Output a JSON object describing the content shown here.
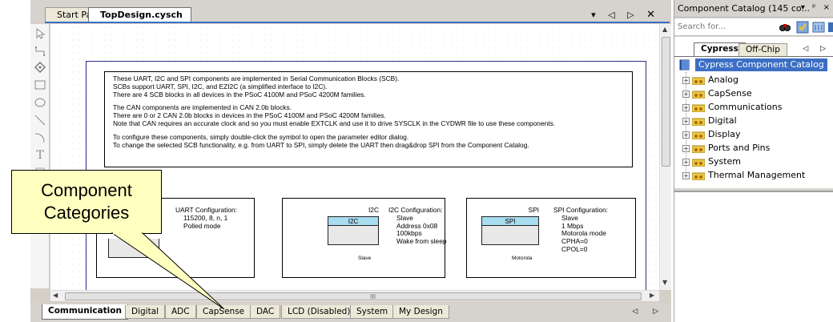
{
  "document": {
    "tabs": [
      {
        "label": "Start Page",
        "active": false
      },
      {
        "label": "TopDesign.cysch",
        "active": true
      }
    ],
    "controls": [
      "▾",
      "◁",
      "▷",
      "✕"
    ]
  },
  "toolbox": {
    "tools": [
      "pointer-tool-icon",
      "wire-tool-icon",
      "diamond-tool-icon",
      "rectangle-tool-icon",
      "ellipse-tool-icon",
      "line-tool-icon",
      "arc-tool-icon",
      "text-tool-icon",
      "image-tool-icon"
    ],
    "text_tool_glyph": "T"
  },
  "schematic": {
    "note_paragraphs": [
      [
        "These UART, I2C and SPI components are implemented in Serial Communication Blocks (SCB).",
        "SCBs support UART, SPI, I2C, and EZI2C (a simplified interface to I2C).",
        "There are 4 SCB blocks in all devices in the PSoC 4100M and PSoC 4200M families."
      ],
      [
        "The CAN components are implemented in CAN 2.0b blocks.",
        "There are 0 or 2 CAN 2.0b blocks in devices in the PSoC 4100M and PSoC 4200M families.",
        "Note that CAN requires an accurate clock and so you must enable EXTCLK and use it to drive SYSCLK in the CYDWR file to use these components."
      ],
      [
        "To configure these components, simply double-click the symbol to open the parameter editor dialog.",
        "To change the selected SCB functionality, e.g. from UART to SPI, simply delete the UART then drag&drop SPI from the Component Catalog."
      ]
    ],
    "uart": {
      "config_title": "UART Configuration:",
      "config_values": [
        "115200, 8, n, 1",
        "Polled mode"
      ],
      "symbol_sub_fragment": "d"
    },
    "i2c": {
      "symbol_name": "I2C",
      "symbol_band": "I2C",
      "symbol_sub": "Slave",
      "config_title": "I2C Configuration:",
      "config_values": [
        "Slave",
        "Address 0x08",
        "100kbps",
        "Wake from sleep"
      ]
    },
    "spi": {
      "symbol_name": "SPI",
      "symbol_band": "SPI",
      "symbol_sub": "Motorola",
      "config_title": "SPI Configuration:",
      "config_values": [
        "Slave",
        "1 Mbps",
        "Motorola mode",
        "CPHA=0",
        "CPOL=0"
      ]
    }
  },
  "scrollbars": {
    "vertical": {
      "up": "▲",
      "down": "▼"
    },
    "horizontal": {
      "left": "◀",
      "right": "▶",
      "grip": "III"
    }
  },
  "sheet_tabs": {
    "tabs": [
      "Communication",
      "Digital",
      "ADC",
      "CapSense",
      "DAC",
      "LCD (Disabled)",
      "System",
      "My Design"
    ],
    "active_index": 0,
    "nav": [
      "◁",
      "▷"
    ]
  },
  "callout": {
    "lines": [
      "Component",
      "Categories"
    ],
    "fill": "#ffffc0"
  },
  "catalog": {
    "title": "Component Catalog (145 co...",
    "title_buttons": [
      "▾",
      "ᵖ",
      "×"
    ],
    "search_placeholder": "Search for...",
    "tabs": [
      {
        "label": "Cypress",
        "active": true
      },
      {
        "label": "Off-Chip",
        "active": false
      }
    ],
    "tab_nav": [
      "◁",
      "▷"
    ],
    "root_label": "Cypress Component Catalog",
    "categories": [
      "Analog",
      "CapSense",
      "Communications",
      "Digital",
      "Display",
      "Ports and Pins",
      "System",
      "Thermal Management"
    ],
    "expand_glyph": "+"
  },
  "colors": {
    "selection": "#3c6fc4",
    "symbol_band": "#a8dcef",
    "sheet_border": "#2b2b8a"
  }
}
